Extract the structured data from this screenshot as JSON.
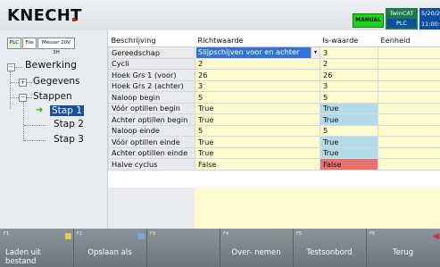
{
  "header": {
    "logo": "KNECHT",
    "mode": "MANUAL",
    "twincat": "TwinCAT",
    "plc": "PLC",
    "date": "5/20/20",
    "time": "11:00:3"
  },
  "toolbar": {
    "plc": "PLC",
    "file": "File",
    "device": "Messer 20V 3H"
  },
  "tree": {
    "root": "Bewerking",
    "gegevens": "Gegevens",
    "stappen": "Stappen",
    "stap1": "Stap 1",
    "stap2": "Stap 2",
    "stap3": "Stap 3"
  },
  "table": {
    "headers": [
      "Beschrijving",
      "Richtwaarde",
      "Is-waarde",
      "Eenheid"
    ],
    "rows": [
      {
        "label": "Gereedschap",
        "value": "Slijpschijven voor en achter",
        "is": "3"
      },
      {
        "label": "Cycli",
        "value": "2",
        "is": "2"
      },
      {
        "label": "Hoek Grs 1 (voor)",
        "value": "26",
        "is": "26"
      },
      {
        "label": "Hoek Grs 2 (achter)",
        "value": "3",
        "is": "3"
      },
      {
        "label": "Naloop begin",
        "value": "5",
        "is": "5"
      },
      {
        "label": "Vóór optillen begin",
        "value": "True",
        "is": "True"
      },
      {
        "label": "Achter optillen begin",
        "value": "True",
        "is": "True"
      },
      {
        "label": "Naloop einde",
        "value": "5",
        "is": "5"
      },
      {
        "label": "Vóór optillen einde",
        "value": "True",
        "is": "True"
      },
      {
        "label": "Achter optillen einde",
        "value": "True",
        "is": "True"
      },
      {
        "label": "Halve cyclus",
        "value": "False",
        "is": "False"
      }
    ]
  },
  "fkeys": [
    {
      "num": "F1",
      "label": "Laden uit\nbestand"
    },
    {
      "num": "F2",
      "label": "Opslaan als"
    },
    {
      "num": "F3",
      "label": ""
    },
    {
      "num": "F4",
      "label": "Over- nemen"
    },
    {
      "num": "F5",
      "label": "Testsonbord"
    },
    {
      "num": "F6",
      "label": "Terug"
    }
  ]
}
